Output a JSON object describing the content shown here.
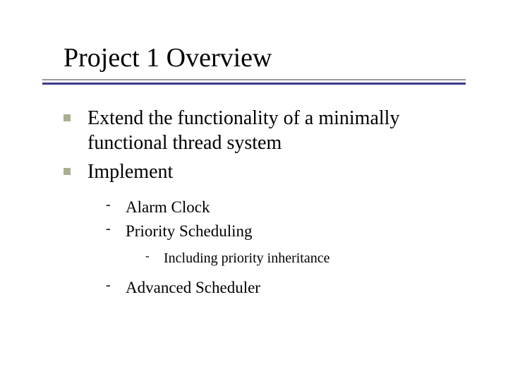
{
  "title": "Project 1 Overview",
  "bullets": {
    "item1": "Extend the functionality of a minimally functional thread system",
    "item2": "Implement",
    "sub1": "Alarm Clock",
    "sub2": "Priority Scheduling",
    "subsub1": "Including priority inheritance",
    "sub3": "Advanced Scheduler"
  }
}
